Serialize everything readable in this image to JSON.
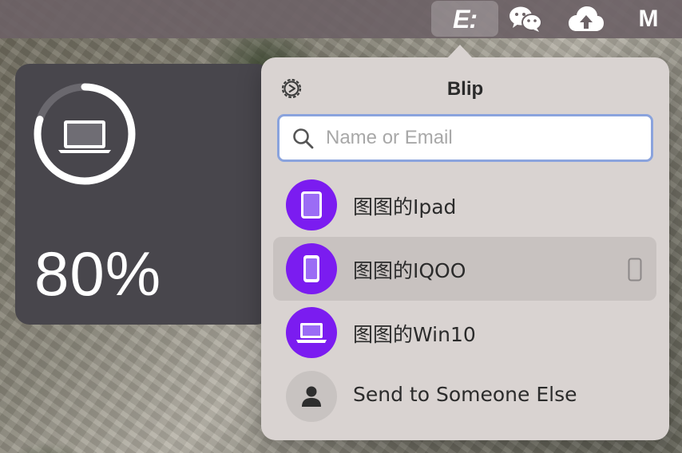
{
  "menubar": {
    "items": [
      {
        "name": "blip",
        "glyph": "E:"
      },
      {
        "name": "wechat",
        "icon": "wechat-icon"
      },
      {
        "name": "cloud-upload",
        "icon": "cloud-upload-icon"
      },
      {
        "name": "mail",
        "glyph": "M"
      }
    ]
  },
  "battery": {
    "percent_label": "80%",
    "percent": 80,
    "device_icon": "laptop-icon"
  },
  "popover": {
    "title": "Blip",
    "settings_icon": "gear-icon",
    "search": {
      "placeholder": "Name or Email",
      "value": "",
      "icon": "search-icon"
    },
    "devices": [
      {
        "label": "图图的Ipad",
        "icon": "tablet-icon",
        "selected": false
      },
      {
        "label": "图图的IQOO",
        "icon": "phone-icon",
        "selected": true,
        "trailing_icon": "phone-outline-icon"
      },
      {
        "label": "图图的Win10",
        "icon": "laptop-icon",
        "selected": false
      },
      {
        "label": "Send to Someone Else",
        "icon": "person-icon",
        "selected": false
      }
    ]
  },
  "colors": {
    "accent_purple": "#7b1cf0",
    "search_border": "#8aa3dd",
    "popover_bg": "#d9d3d1",
    "battery_bg": "#48464c",
    "menubar_bg": "#6c6266"
  }
}
